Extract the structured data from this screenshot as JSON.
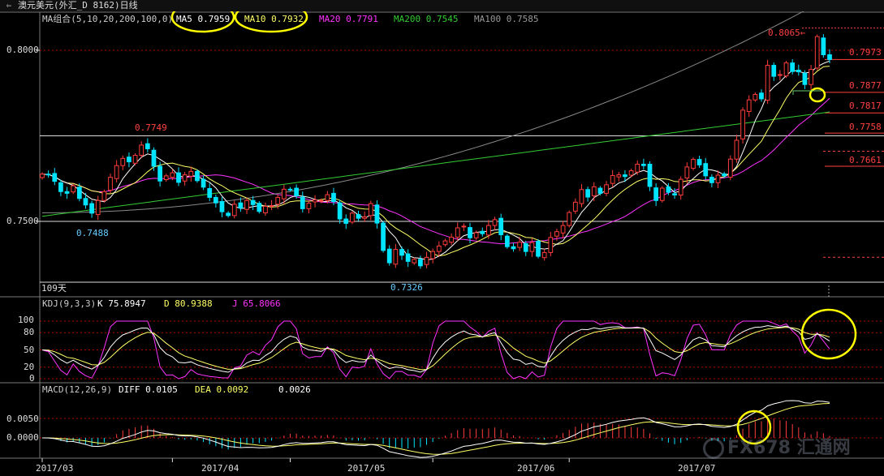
{
  "window": {
    "title": "澳元美元(外汇_D 8162)日线",
    "period_badge": "109天"
  },
  "colors": {
    "up": "#ff3c3c",
    "down": "#00e5ff",
    "ma5": "#ffffff",
    "ma10": "#ffff66",
    "ma20": "#ff33ff",
    "ma200": "#33cc33",
    "ma100": "#888888",
    "price_label": "#ff4040",
    "low_label": "#66ccff",
    "highlight": "#ffff00",
    "grid": "#b00000"
  },
  "main_legend": {
    "prefix": "MA组合(5,10,20,200,100,0)",
    "ma5": "MA5 0.7959",
    "ma10": "MA10 0.7932",
    "ma20": "MA20 0.7791",
    "ma200": "MA200 0.7545",
    "ma100": "MA100 0.7585"
  },
  "y_axis": {
    "top": "0.8000",
    "bottom": "0.7500"
  },
  "price_marks": {
    "high_arrow": "0.8065",
    "r1": "0.7973",
    "r2": "0.7877",
    "r3": "0.7817",
    "r4": "0.7758",
    "r5": "0.7661"
  },
  "annotations": {
    "hi_mar": "0.7749",
    "lo_mar": "0.7488",
    "lo_may": "0.7326"
  },
  "kdj": {
    "legend": "KDJ(9,3,3)",
    "k": "K  75.8947",
    "d": "D  80.9388",
    "j": "J  65.8066",
    "ticks": [
      "100",
      "80",
      "50",
      "20",
      "0"
    ]
  },
  "macd": {
    "legend": "MACD(12,26,9)",
    "diff": "DIFF  0.0105",
    "dea": "DEA  0.0092",
    "macd": "0.0026",
    "ticks": [
      "0.0050",
      "0.0000"
    ]
  },
  "x_axis": [
    "2017/03",
    "2017/04",
    "2017/05",
    "2017/06",
    "2017/07"
  ],
  "watermark": "FX678 汇通网",
  "chart_data": {
    "type": "candlestick",
    "title": "澳元美元(外汇_D 8162)日线",
    "x_range": [
      "2017/03",
      "2017/07"
    ],
    "ylim": [
      0.729,
      0.8075
    ],
    "hlines": [
      0.8,
      0.775,
      0.75
    ],
    "closes": [
      0.7638,
      0.7636,
      0.7617,
      0.7587,
      0.7582,
      0.7604,
      0.7567,
      0.7548,
      0.7524,
      0.7561,
      0.7587,
      0.7629,
      0.7663,
      0.7684,
      0.7674,
      0.7693,
      0.7723,
      0.7712,
      0.7661,
      0.7618,
      0.7633,
      0.7642,
      0.7614,
      0.7636,
      0.7646,
      0.7619,
      0.76,
      0.757,
      0.7554,
      0.7528,
      0.7517,
      0.755,
      0.7539,
      0.7561,
      0.7549,
      0.7529,
      0.7544,
      0.7546,
      0.757,
      0.7594,
      0.7593,
      0.7575,
      0.7537,
      0.7553,
      0.7563,
      0.7561,
      0.7578,
      0.7558,
      0.7507,
      0.7494,
      0.7524,
      0.7509,
      0.7513,
      0.7552,
      0.7495,
      0.7415,
      0.7379,
      0.7418,
      0.7401,
      0.7383,
      0.7389,
      0.737,
      0.7395,
      0.7412,
      0.7428,
      0.7443,
      0.7454,
      0.7481,
      0.7486,
      0.7452,
      0.7467,
      0.7464,
      0.7488,
      0.7505,
      0.7461,
      0.7426,
      0.742,
      0.7439,
      0.7412,
      0.7438,
      0.7398,
      0.7409,
      0.7453,
      0.747,
      0.7488,
      0.7526,
      0.7556,
      0.7593,
      0.7571,
      0.7601,
      0.7582,
      0.7607,
      0.7634,
      0.7636,
      0.7631,
      0.7648,
      0.7667,
      0.7663,
      0.7602,
      0.7561,
      0.7597,
      0.7585,
      0.7577,
      0.7623,
      0.7659,
      0.7681,
      0.7665,
      0.7633,
      0.7613,
      0.7635,
      0.7633,
      0.7682,
      0.7737,
      0.7825,
      0.7855,
      0.7871,
      0.7858,
      0.7956,
      0.7924,
      0.7929,
      0.7963,
      0.7938,
      0.7937,
      0.79,
      0.7944,
      0.804,
      0.7987,
      0.7973
    ],
    "ma_values": {
      "MA5": 0.7959,
      "MA10": 0.7932,
      "MA20": 0.7791,
      "MA200": 0.7545,
      "MA100": 0.7585
    },
    "price_levels": [
      0.8065,
      0.7973,
      0.7877,
      0.7817,
      0.7758,
      0.7661
    ],
    "kdj": {
      "ylim": [
        0,
        100
      ],
      "K": 75.8947,
      "D": 80.9388,
      "J": 65.8066
    },
    "macd": {
      "DIFF": 0.0105,
      "DEA": 0.0092,
      "MACD": 0.0026
    }
  }
}
